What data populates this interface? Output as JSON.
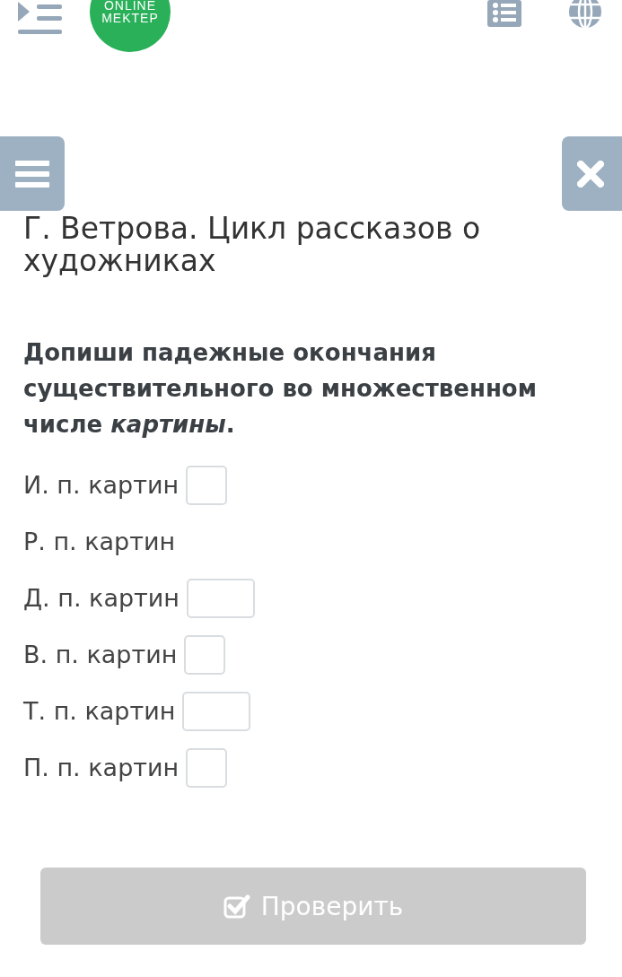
{
  "header": {
    "logo": [
      "ONLINE",
      "MEKTEP"
    ]
  },
  "title": "Г. Ветрова. Цикл рассказов о художниках",
  "task": "Допиши падежные окончания существительного во множественном числе *картины*.",
  "rows": [
    {
      "label": "И. п. картин",
      "kind": "narrow"
    },
    {
      "label": "Р. п. картин",
      "kind": "none"
    },
    {
      "label": "Д. п. картин",
      "kind": "wide"
    },
    {
      "label": "В. п. картин",
      "kind": "narrow"
    },
    {
      "label": "Т. п. картин",
      "kind": "wide"
    },
    {
      "label": "П. п. картин",
      "kind": "narrow"
    }
  ],
  "check_button": {
    "label": "Проверить",
    "disabled": true
  }
}
